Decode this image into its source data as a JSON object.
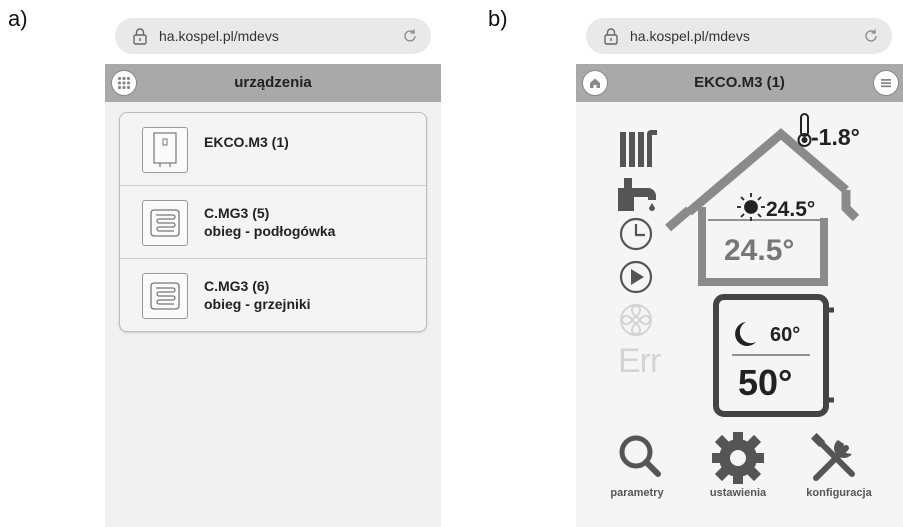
{
  "panels": {
    "a": {
      "label": "a)",
      "url": "ha.kospel.pl/mdevs",
      "header_title": "urządzenia",
      "devices": [
        {
          "name": "EKCO.M3 (1)",
          "subtitle": ""
        },
        {
          "name": "C.MG3 (5)",
          "subtitle": "obieg - podłogówka"
        },
        {
          "name": "C.MG3 (6)",
          "subtitle": "obieg - grzejniki"
        }
      ]
    },
    "b": {
      "label": "b)",
      "url": "ha.kospel.pl/mdevs",
      "header_title": "EKCO.M3 (1)",
      "outdoor_temp": "-1.8°",
      "day_setpoint": "24.5°",
      "room_temp": "24.5°",
      "night_setpoint": "60°",
      "water_temp": "50°",
      "err_label": "Err",
      "bottom_buttons": {
        "parametry": "parametry",
        "ustawienia": "ustawienia",
        "konfiguracja": "konfiguracja"
      }
    }
  },
  "colors": {
    "header_bg": "#a9a9a9",
    "icon_dark": "#555555",
    "icon_light": "#d4d4d4",
    "house_stroke": "#8a8a8a"
  }
}
